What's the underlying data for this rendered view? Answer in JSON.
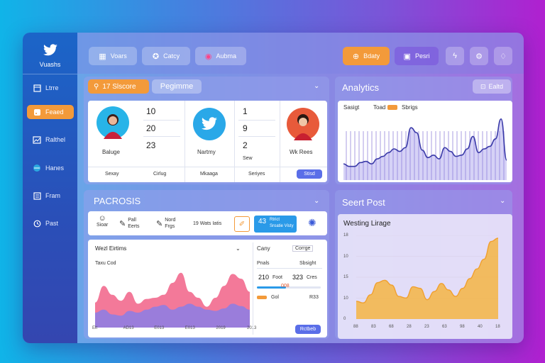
{
  "sidebar": {
    "logo_text": "Vuashs",
    "items": [
      {
        "label": "Ltrre",
        "icon": "grid-icon",
        "active": false
      },
      {
        "label": "Feaed",
        "icon": "rss-icon",
        "active": true
      },
      {
        "label": "Ralthel",
        "icon": "chart-icon",
        "active": false
      },
      {
        "label": "Hanes",
        "icon": "globe-icon",
        "active": false
      },
      {
        "label": "Fram",
        "icon": "document-icon",
        "active": false
      },
      {
        "label": "Past",
        "icon": "clock-icon",
        "active": false
      }
    ]
  },
  "topbar": {
    "buttons": [
      {
        "label": "Voars",
        "icon": "calendar-icon"
      },
      {
        "label": "Catcy",
        "icon": "star-icon"
      },
      {
        "label": "Aubma",
        "icon": "camera-icon"
      }
    ],
    "right_buttons": [
      {
        "label": "Bdaty",
        "icon": "plus-icon"
      },
      {
        "label": "Pesri",
        "icon": "user-icon"
      }
    ],
    "icon_buttons": [
      "bolt-icon",
      "gear-icon",
      "bell-icon"
    ]
  },
  "profiles": {
    "search_pill": "17 Slscore",
    "tab_label": "Pegimme",
    "cols": [
      {
        "name": "Baluge",
        "values": [
          "10",
          "20",
          "23"
        ],
        "footer": "Sexay"
      },
      {
        "name": "Nartmy",
        "values": [],
        "footer": "Cirlug"
      },
      {
        "name": "",
        "values": [
          "1",
          "9",
          "2"
        ],
        "sub": "Sew",
        "footer": "Mkaaga"
      },
      {
        "name": "Wk Rees",
        "values": [],
        "footer": "Seriyes"
      }
    ],
    "button": "Stisd"
  },
  "analytics": {
    "title": "Analytics",
    "button": "Ealtd",
    "legend": [
      "Sasigt",
      "Toad",
      "Sbrigs"
    ],
    "series": [
      0.26,
      0.22,
      0.22,
      0.28,
      0.3,
      0.26,
      0.34,
      0.38,
      0.44,
      0.5,
      0.46,
      0.52,
      0.84,
      0.76,
      0.48,
      0.36,
      0.4,
      0.34,
      0.52,
      0.46,
      0.38,
      0.4,
      0.5,
      0.7,
      0.44,
      0.5,
      0.54,
      0.66,
      0.98,
      0.32
    ]
  },
  "process": {
    "title": "PACROSIS",
    "tools": [
      {
        "label": "Sioar",
        "icon": "user-icon"
      },
      {
        "label": "Pall Eerts",
        "icon": "pen-icon"
      },
      {
        "label": "Nord Frgs",
        "icon": "pen-icon"
      },
      {
        "label": "19 Wats Iatis",
        "icon": ""
      }
    ],
    "highlight_label": "Rtrict",
    "highlight_value": "43",
    "highlight_sub": "Sroatie Visty",
    "chart_title": "Wezl Eirtims",
    "chart_sub": "Taxu Cod",
    "x_labels": [
      "Elt",
      "AD13",
      "E013",
      "E013",
      "2019",
      "2013"
    ],
    "side": {
      "title": "Cany",
      "dropdown": "Corrge",
      "row_label": "Pnals",
      "row_right": "Sbsight",
      "stat1": "210",
      "stat1_sub": "Foot",
      "stat2": "323",
      "stat2_sub": "Cres",
      "bar_label": "008",
      "bar_value": 0.45,
      "bar2_label": "Gol",
      "bar2_right": "R33",
      "button": "Rctbeb"
    },
    "series_pink": [
      0.42,
      0.7,
      0.55,
      0.45,
      0.6,
      0.4,
      0.48,
      0.5,
      0.55,
      0.75,
      0.92,
      0.6,
      0.5,
      0.35,
      0.5,
      0.7,
      0.9,
      0.82,
      0.6
    ],
    "series_purple": [
      0.25,
      0.3,
      0.22,
      0.2,
      0.28,
      0.25,
      0.3,
      0.35,
      0.38,
      0.3,
      0.35,
      0.4,
      0.35,
      0.3,
      0.28,
      0.32,
      0.4,
      0.36,
      0.3
    ]
  },
  "post": {
    "title": "Seert Post",
    "chart_title": "Westing Lirage",
    "y_labels": [
      "18",
      "10",
      "15",
      "10",
      "0"
    ],
    "x_labels": [
      "88",
      "83",
      "68",
      "28",
      "23",
      "63",
      "98",
      "40",
      "18"
    ],
    "series": [
      0.22,
      0.2,
      0.3,
      0.45,
      0.48,
      0.42,
      0.28,
      0.26,
      0.4,
      0.38,
      0.24,
      0.34,
      0.44,
      0.36,
      0.28,
      0.38,
      0.5,
      0.62,
      0.74,
      0.96,
      1.0
    ]
  },
  "colors": {
    "accent": "#f39a3a",
    "blue": "#5a6ee8",
    "pink": "#f26a8e",
    "purple": "#8a7ee6",
    "orange_chart": "#f5b544"
  }
}
